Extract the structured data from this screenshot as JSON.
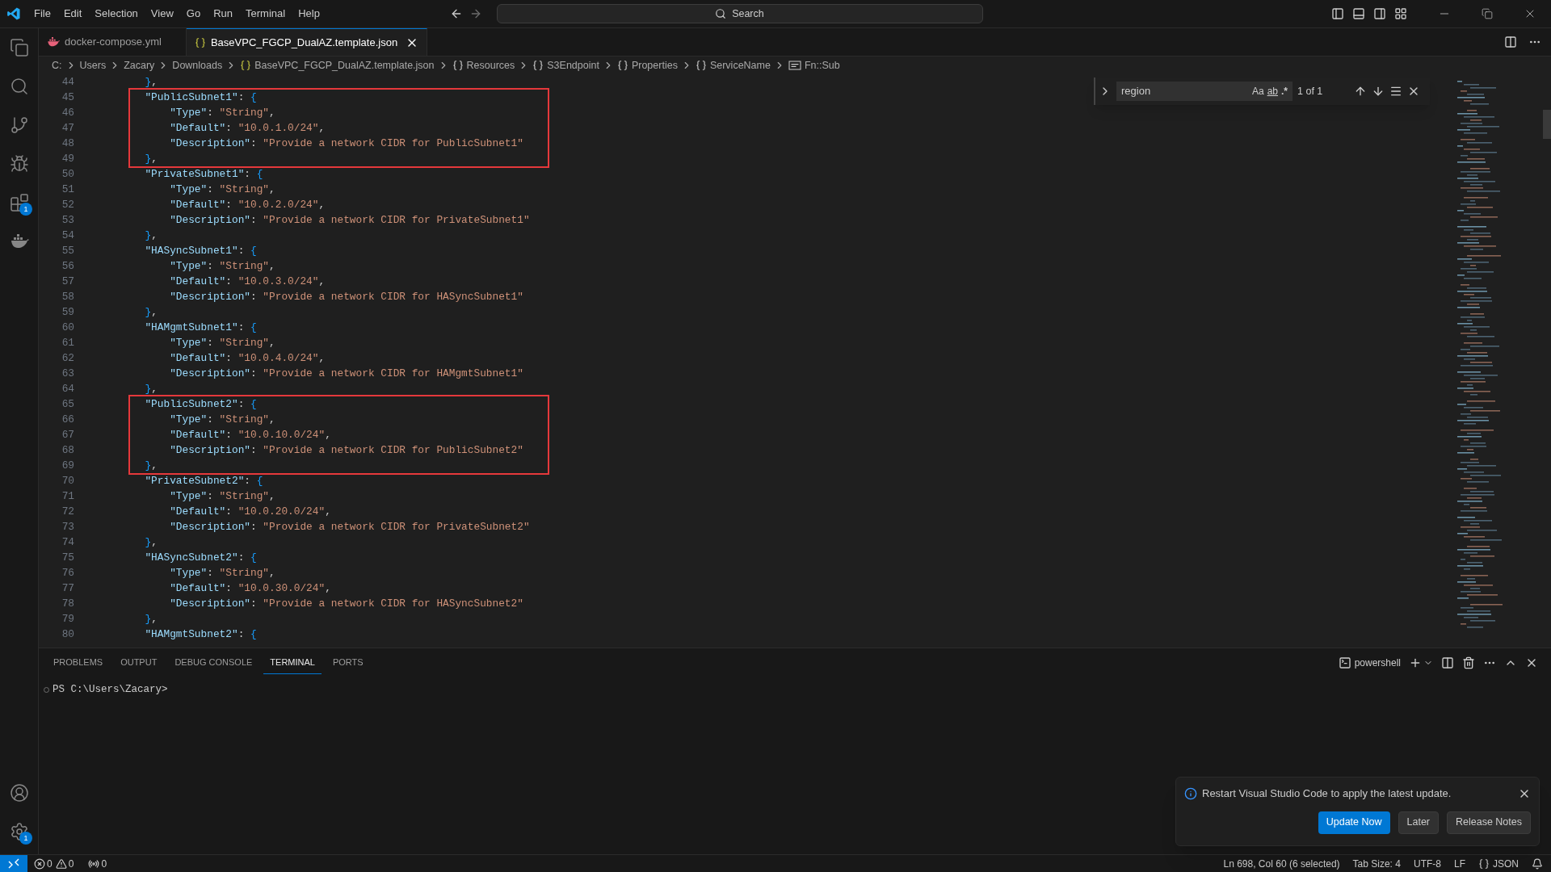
{
  "menu": [
    "File",
    "Edit",
    "Selection",
    "View",
    "Go",
    "Run",
    "Terminal",
    "Help"
  ],
  "search": {
    "placeholder": "Search"
  },
  "activity_bar": {
    "top": [
      {
        "kind": "explorer"
      },
      {
        "kind": "search"
      },
      {
        "kind": "source-control"
      },
      {
        "kind": "run-debug"
      },
      {
        "kind": "extensions",
        "badge": "1"
      },
      {
        "kind": "docker"
      }
    ],
    "bottom": [
      {
        "kind": "account"
      },
      {
        "kind": "settings",
        "badge": "1"
      }
    ]
  },
  "tabs": [
    {
      "label": "docker-compose.yml",
      "kind": "docker",
      "selected": false
    },
    {
      "label": "BaseVPC_FGCP_DualAZ.template.json",
      "kind": "json",
      "selected": true
    }
  ],
  "breadcrumb": [
    {
      "label": "C:",
      "kind": "folder"
    },
    {
      "label": "Users",
      "kind": "folder"
    },
    {
      "label": "Zacary",
      "kind": "folder"
    },
    {
      "label": "Downloads",
      "kind": "folder"
    },
    {
      "label": "BaseVPC_FGCP_DualAZ.template.json",
      "kind": "file"
    },
    {
      "label": "Resources",
      "kind": "object"
    },
    {
      "label": "S3Endpoint",
      "kind": "object"
    },
    {
      "label": "Properties",
      "kind": "object"
    },
    {
      "label": "ServiceName",
      "kind": "object"
    },
    {
      "label": "Fn::Sub",
      "kind": "string"
    }
  ],
  "find": {
    "query": "region",
    "result": "1 of 1",
    "options": [
      {
        "label": "Aa",
        "kind": "case"
      },
      {
        "label": "ab",
        "kind": "word"
      },
      {
        "label": ".*",
        "kind": "regex"
      }
    ]
  },
  "editor": {
    "lines": [
      {
        "number": "44",
        "text": "        },",
        "boxed": false
      },
      {
        "number": "45",
        "text": "        \"PublicSubnet1\": {",
        "boxed": true
      },
      {
        "number": "46",
        "text": "            \"Type\": \"String\",",
        "boxed": true
      },
      {
        "number": "47",
        "text": "            \"Default\": \"10.0.1.0/24\",",
        "boxed": true
      },
      {
        "number": "48",
        "text": "            \"Description\": \"Provide a network CIDR for PublicSubnet1\"",
        "boxed": true
      },
      {
        "number": "49",
        "text": "        },",
        "boxed": true
      },
      {
        "number": "50",
        "text": "        \"PrivateSubnet1\": {",
        "boxed": false
      },
      {
        "number": "51",
        "text": "            \"Type\": \"String\",",
        "boxed": false
      },
      {
        "number": "52",
        "text": "            \"Default\": \"10.0.2.0/24\",",
        "boxed": false
      },
      {
        "number": "53",
        "text": "            \"Description\": \"Provide a network CIDR for PrivateSubnet1\"",
        "boxed": false
      },
      {
        "number": "54",
        "text": "        },",
        "boxed": false
      },
      {
        "number": "55",
        "text": "        \"HASyncSubnet1\": {",
        "boxed": false
      },
      {
        "number": "56",
        "text": "            \"Type\": \"String\",",
        "boxed": false
      },
      {
        "number": "57",
        "text": "            \"Default\": \"10.0.3.0/24\",",
        "boxed": false
      },
      {
        "number": "58",
        "text": "            \"Description\": \"Provide a network CIDR for HASyncSubnet1\"",
        "boxed": false
      },
      {
        "number": "59",
        "text": "        },",
        "boxed": false
      },
      {
        "number": "60",
        "text": "        \"HAMgmtSubnet1\": {",
        "boxed": false
      },
      {
        "number": "61",
        "text": "            \"Type\": \"String\",",
        "boxed": false
      },
      {
        "number": "62",
        "text": "            \"Default\": \"10.0.4.0/24\",",
        "boxed": false
      },
      {
        "number": "63",
        "text": "            \"Description\": \"Provide a network CIDR for HAMgmtSubnet1\"",
        "boxed": false
      },
      {
        "number": "64",
        "text": "        },",
        "boxed": false
      },
      {
        "number": "65",
        "text": "        \"PublicSubnet2\": {",
        "boxed": true
      },
      {
        "number": "66",
        "text": "            \"Type\": \"String\",",
        "boxed": true
      },
      {
        "number": "67",
        "text": "            \"Default\": \"10.0.10.0/24\",",
        "boxed": true
      },
      {
        "number": "68",
        "text": "            \"Description\": \"Provide a network CIDR for PublicSubnet2\"",
        "boxed": true
      },
      {
        "number": "69",
        "text": "        },",
        "boxed": true
      },
      {
        "number": "70",
        "text": "        \"PrivateSubnet2\": {",
        "boxed": false
      },
      {
        "number": "71",
        "text": "            \"Type\": \"String\",",
        "boxed": false
      },
      {
        "number": "72",
        "text": "            \"Default\": \"10.0.20.0/24\",",
        "boxed": false
      },
      {
        "number": "73",
        "text": "            \"Description\": \"Provide a network CIDR for PrivateSubnet2\"",
        "boxed": false
      },
      {
        "number": "74",
        "text": "        },",
        "boxed": false
      },
      {
        "number": "75",
        "text": "        \"HASyncSubnet2\": {",
        "boxed": false
      },
      {
        "number": "76",
        "text": "            \"Type\": \"String\",",
        "boxed": false
      },
      {
        "number": "77",
        "text": "            \"Default\": \"10.0.30.0/24\",",
        "boxed": false
      },
      {
        "number": "78",
        "text": "            \"Description\": \"Provide a network CIDR for HASyncSubnet2\"",
        "boxed": false
      },
      {
        "number": "79",
        "text": "        },",
        "boxed": false
      },
      {
        "number": "80",
        "text": "        \"HAMgmtSubnet2\": {",
        "boxed": false
      }
    ]
  },
  "panel": {
    "tabs": [
      {
        "label": "PROBLEMS",
        "selected": false
      },
      {
        "label": "OUTPUT",
        "selected": false
      },
      {
        "label": "DEBUG CONSOLE",
        "selected": false
      },
      {
        "label": "TERMINAL",
        "selected": true
      },
      {
        "label": "PORTS",
        "selected": false
      }
    ],
    "shell": "powershell",
    "prompt": "PS C:\\Users\\Zacary>"
  },
  "notification": {
    "message": "Restart Visual Studio Code to apply the latest update.",
    "buttons": [
      {
        "label": "Update Now",
        "kind": "primary"
      },
      {
        "label": "Later",
        "kind": "secondary"
      },
      {
        "label": "Release Notes",
        "kind": "secondary"
      }
    ]
  },
  "status_bar": {
    "errors": "0",
    "warnings": "0",
    "ports": "0",
    "right": [
      {
        "label": "Ln 698, Col 60 (6 selected)",
        "kind": "text"
      },
      {
        "label": "Tab Size: 4",
        "kind": "text"
      },
      {
        "label": "UTF-8",
        "kind": "text"
      },
      {
        "label": "LF",
        "kind": "text"
      },
      {
        "label": "JSON",
        "kind": "language"
      }
    ]
  }
}
